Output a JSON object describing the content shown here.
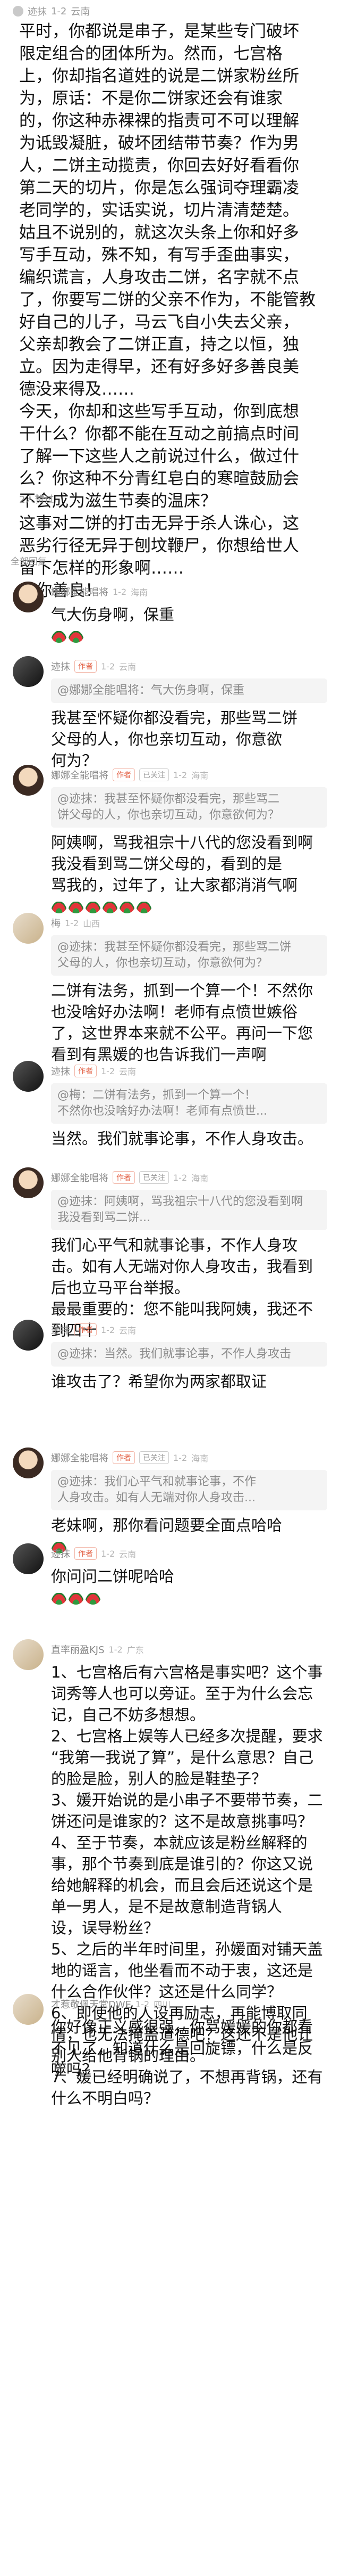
{
  "post": {
    "author": "迹抹",
    "time": "1-2",
    "location": "云南",
    "lines": [
      "平时，你都说是串子，是某些专门破坏",
      "限定组合的团体所为。然而，七宫格",
      "上，你却指名道姓的说是二饼家粉丝所",
      "为，原话：不是你二饼家还会有谁家",
      "的，你这种赤裸裸的指责可不可以理解",
      "为诋毁凝脏，破坏团结带节奏？作为男",
      "人，二饼主动揽责，你回去好好看看你",
      "第二天的切片，你是怎么强词夺理霸凌",
      "老同学的，实话实说，切片清清楚楚。",
      "姑且不说别的，就这次头条上你和好多",
      "写手互动，殊不知，有写手歪曲事实，",
      "编织谎言，人身攻击二饼，名字就不点",
      "了，你要写二饼的父亲不作为，不能管教",
      "好自己的儿子，马云飞自小失去父亲，",
      "父亲却教会了二饼正直，持之以恒，独",
      "立。因为走得早，还有好多好多善良美",
      "德没来得及……",
      "今天，你却和这些写手互动，你到底想",
      "干什么？你都不能在互动之前搞点时间",
      "了解一下这些人之前说过什么，做过什",
      "么？你这种不分青红皂白的寒暄鼓励会",
      "不会成为滋生节奏的温床？",
      "这事对二饼的打击无异于杀人诛心，这",
      "恶劣行径无异于刨坟鞭尸，你想给世人",
      "留下怎样的形象啊……",
      "劝你善良！"
    ],
    "likes": "2人赞过"
  },
  "section_title": "全部回复",
  "comments": [
    {
      "user": "娜娜全能唱将",
      "tags": [],
      "time": "1-2",
      "location": "海南",
      "quote": [],
      "lines": [
        "气大伤身啊，保重"
      ],
      "emoji_count": 2
    },
    {
      "user": "迹抹",
      "tags": [
        "作者"
      ],
      "time": "1-2",
      "location": "云南",
      "quote": [
        "@娜娜全能唱将：气大伤身啊，保重"
      ],
      "lines": [
        "我甚至怀疑你都没看完，那些骂二饼",
        "父母的人，你也亲切互动，你意欲",
        "何为？"
      ],
      "emoji_count": 0
    },
    {
      "user": "娜娜全能唱将",
      "tags": [
        "作者",
        "已关注"
      ],
      "time": "1-2",
      "location": "海南",
      "quote": [
        "@迹抹：我甚至怀疑你都没看完，那些骂二",
        "饼父母的人，你也亲切互动，你意欲何为？"
      ],
      "lines": [
        "阿姨啊，骂我祖宗十八代的您没看到啊",
        "",
        "我没看到骂二饼父母的，看到的是",
        "骂我的，过年了，让大家都消消气啊"
      ],
      "emoji_count": 6
    },
    {
      "user": "梅",
      "tags": [],
      "time": "1-2",
      "location": "山西",
      "quote": [
        "@迹抹：我甚至怀疑你都没看完，那些骂二饼",
        "父母的人，你也亲切互动，你意欲何为？"
      ],
      "lines": [
        "二饼有法务，抓到一个算一个！不然你",
        "也没啥好办法啊！老师有点愤世嫉俗",
        "了，这世界本来就不公平。再问一下您",
        "看到有黑媛的也告诉我们一声啊"
      ],
      "emoji_count": 0
    },
    {
      "user": "迹抹",
      "tags": [
        "作者"
      ],
      "time": "1-2",
      "location": "云南",
      "quote": [
        "@梅：二饼有法务，抓到一个算一个！",
        "不然你也没啥好办法啊！老师有点愤世..."
      ],
      "lines": [
        "当然。我们就事论事，不作人身攻击。"
      ],
      "emoji_count": 0
    },
    {
      "user": "娜娜全能唱将",
      "tags": [
        "作者",
        "已关注"
      ],
      "time": "1-2",
      "location": "海南",
      "quote": [
        "@迹抹：阿姨啊，骂我祖宗十八代的您没看到啊",
        "我没看到骂二饼..."
      ],
      "lines": [
        "我们心平气和就事论事，不作人身攻",
        "击。如有人无端对你人身攻击，我看到",
        "后也立马平台举报。",
        "最最重要的：您不能叫我阿姨，我还不",
        "到四十"
      ],
      "emoji_count": 0
    },
    {
      "user": "迹抹",
      "tags": [
        "作者"
      ],
      "time": "1-2",
      "location": "云南",
      "quote": [
        "@迹抹：当然。我们就事论事，不作人身攻击"
      ],
      "lines": [
        "谁攻击了？希望你为两家都取证"
      ],
      "emoji_count": 0
    },
    {
      "user": "娜娜全能唱将",
      "tags": [
        "作者",
        "已关注"
      ],
      "time": "1-2",
      "location": "海南",
      "quote": [
        "@迹抹：我们心平气和就事论事，不作",
        "人身攻击。如有人无端对你人身攻击..."
      ],
      "lines": [
        "老妹啊，那你看问题要全面点哈哈"
      ],
      "emoji_count": 1
    },
    {
      "user": "迹抹",
      "tags": [
        "作者"
      ],
      "time": "1-2",
      "location": "云南",
      "quote": [],
      "lines": [
        "你问问二饼呢哈哈"
      ],
      "emoji_count": 3
    },
    {
      "user": "直率丽盈KJS",
      "tags": [],
      "time": "1-2",
      "location": "广东",
      "quote": [],
      "lines": [
        "1、七宫格后有六宫格是事实吧？这个事",
        "词秀等人也可以旁证。至于为什么会忘",
        "记，自己不妨多想想。",
        "2、七宫格上娱等人已经多次提醒，要求",
        "“我第一我说了算”，是什么意思？自己",
        "的脸是脸，别人的脸是鞋垫子？",
        "3、媛开始说的是小串子不要带节奏，二",
        "饼还问是谁家的？这不是故意挑事吗？",
        "4、至于节奏，本就应该是粉丝解释的",
        "事，那个节奏到底是谁引的？你这又说",
        "给她解释的机会，而且会后还说这个是",
        "单一男人，是不是故意制造背锅人",
        "设，误导粉丝？",
        "5、之后的半年时间里，孙媛面对铺天盖",
        "地的谣言，他坐看而不动于衷，这还是",
        "什么合作伙伴？这还是什么同学？",
        "6、即使他的人设再励志，再能博取同",
        "情，也无法掩盖道德吧？这还不是他让",
        "别人给他背锅的理由。",
        "7、媛已经明确说了，不想再背锅，还有",
        "什么不明白吗？"
      ],
      "emoji_count": 0
    },
    {
      "user": "才惹敬佩天堂DWE",
      "tags": [],
      "time": "1-2",
      "location": "四川",
      "quote": [],
      "lines": [
        "你好像正义感很强，你骂媛媛的你都看",
        "不见了，知道什么是回旋镖，什么是反",
        "噬吗？"
      ],
      "emoji_count": 0
    }
  ]
}
